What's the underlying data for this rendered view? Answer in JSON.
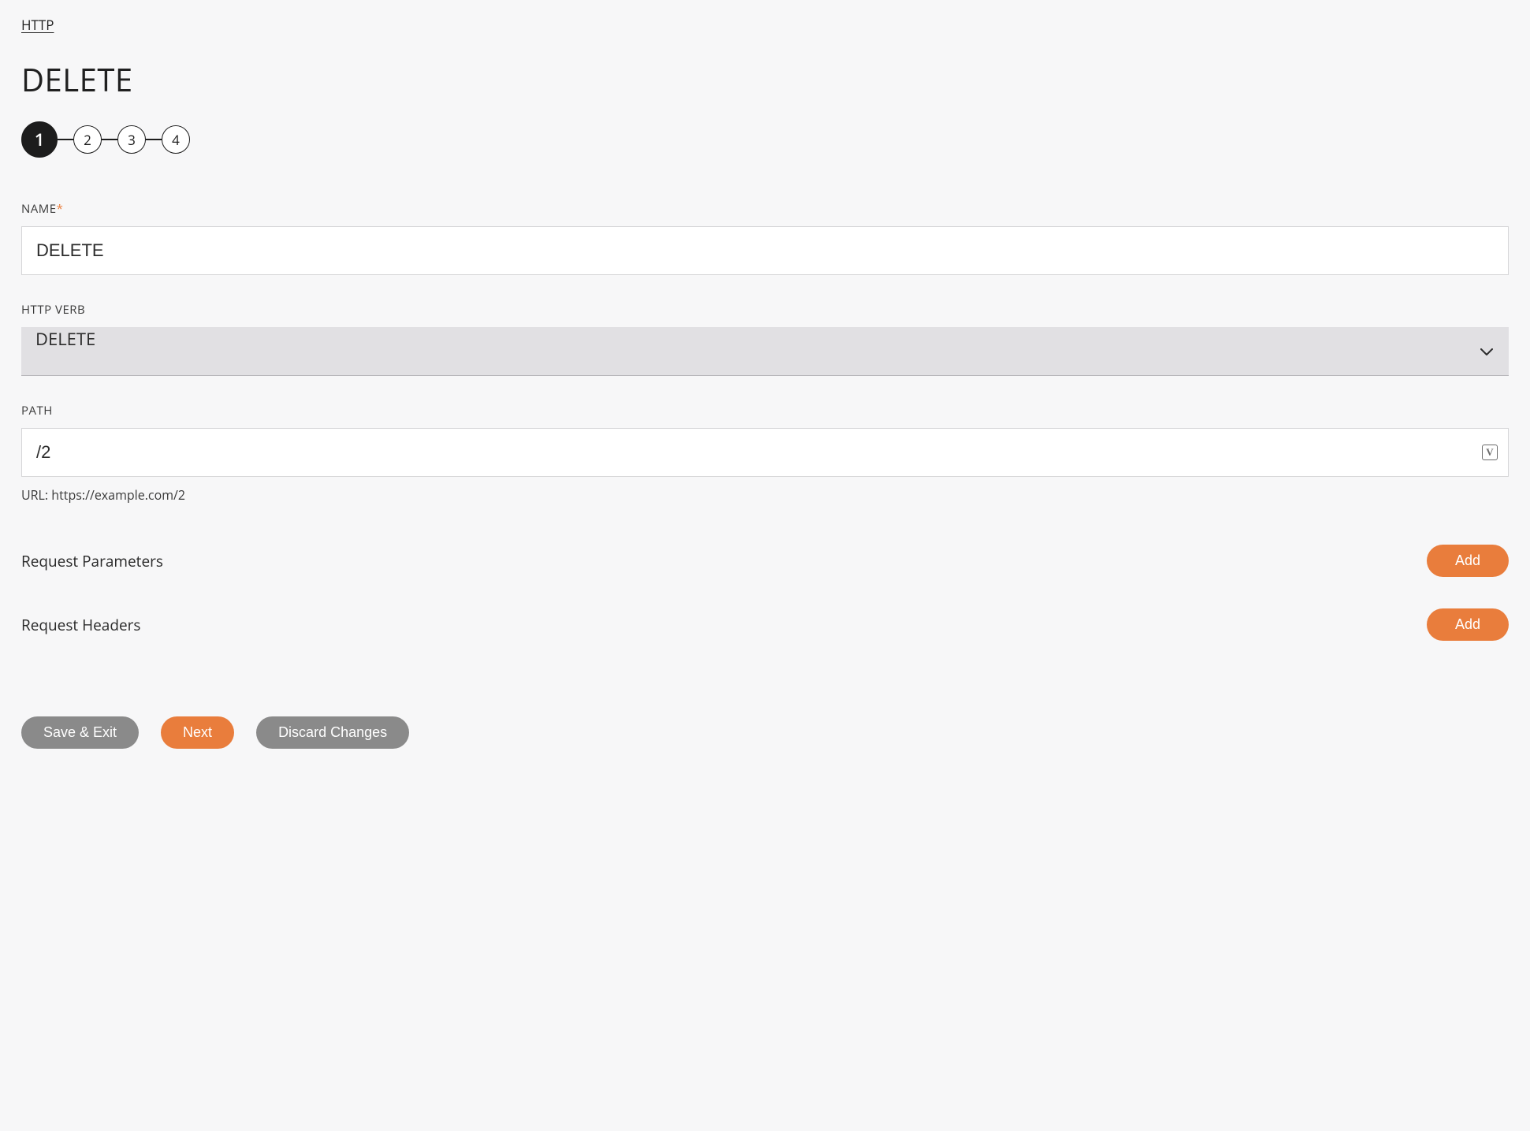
{
  "breadcrumb": {
    "label": "HTTP"
  },
  "page": {
    "title": "DELETE"
  },
  "stepper": {
    "steps": [
      "1",
      "2",
      "3",
      "4"
    ],
    "active_index": 0
  },
  "fields": {
    "name": {
      "label": "NAME",
      "required_mark": "*",
      "value": "DELETE"
    },
    "verb": {
      "label": "HTTP VERB",
      "value": "DELETE"
    },
    "path": {
      "label": "PATH",
      "value": "/2",
      "variable_icon": "V"
    },
    "url_helper": "URL: https://example.com/2"
  },
  "sections": {
    "params": {
      "label": "Request Parameters",
      "add_button": "Add"
    },
    "headers": {
      "label": "Request Headers",
      "add_button": "Add"
    }
  },
  "footer": {
    "save_exit": "Save & Exit",
    "next": "Next",
    "discard": "Discard Changes"
  }
}
